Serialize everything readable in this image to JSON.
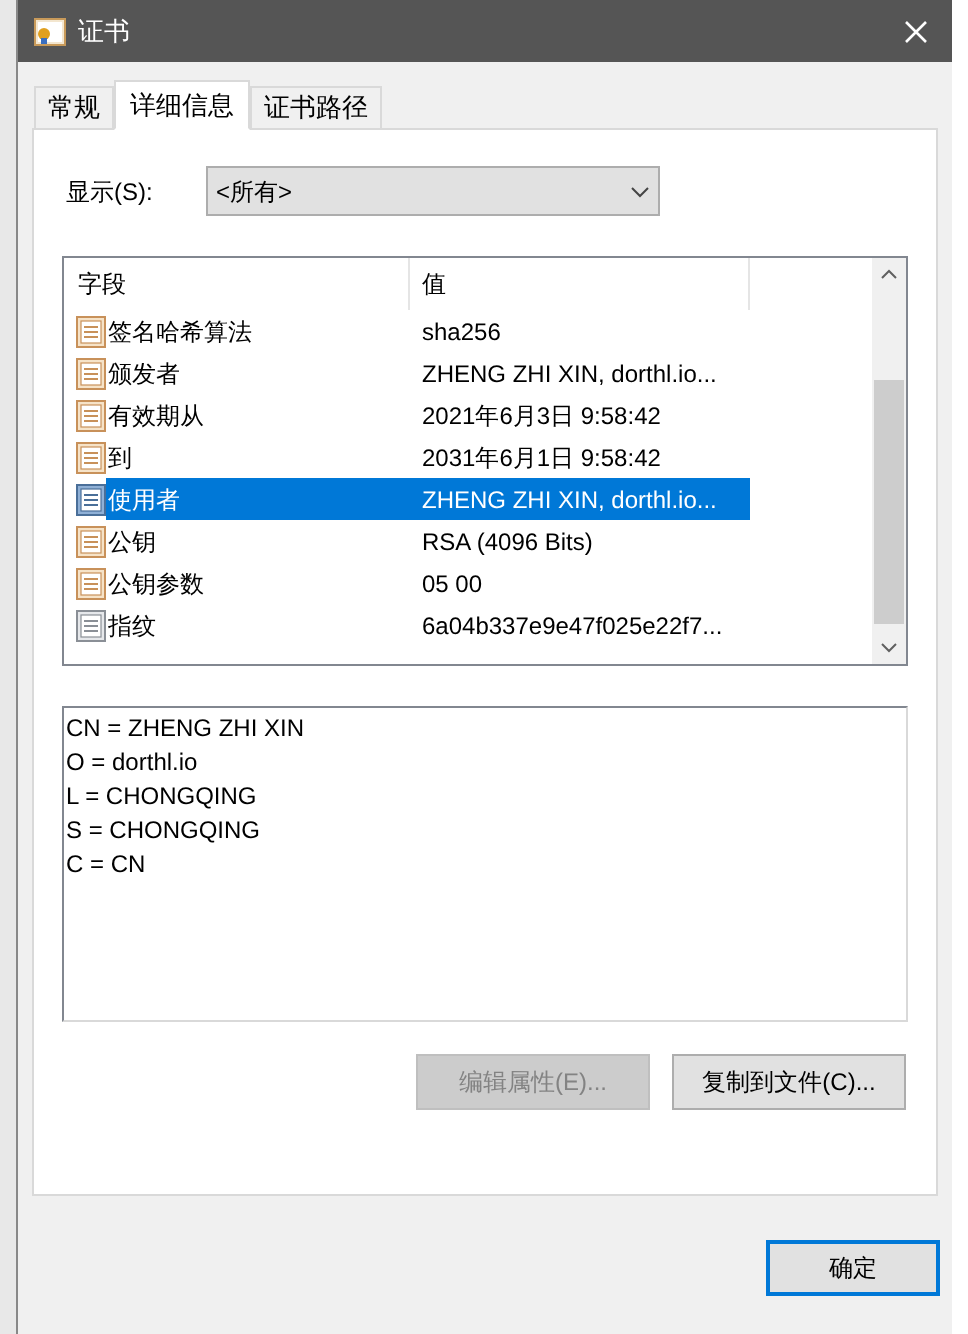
{
  "window": {
    "title": "证书"
  },
  "tabs": [
    {
      "label": "常规",
      "selected": false
    },
    {
      "label": "详细信息",
      "selected": true
    },
    {
      "label": "证书路径",
      "selected": false
    }
  ],
  "show": {
    "label": "显示(S):",
    "value": "<所有>"
  },
  "table": {
    "columns": [
      "字段",
      "值"
    ],
    "rows": [
      {
        "field": "签名哈希算法",
        "value": "sha256",
        "kind": "field",
        "selected": false
      },
      {
        "field": "颁发者",
        "value": "ZHENG ZHI XIN, dorthl.io...",
        "kind": "field",
        "selected": false
      },
      {
        "field": "有效期从",
        "value": "2021年6月3日 9:58:42",
        "kind": "field",
        "selected": false
      },
      {
        "field": "到",
        "value": "2031年6月1日 9:58:42",
        "kind": "field",
        "selected": false
      },
      {
        "field": "使用者",
        "value": "ZHENG ZHI XIN, dorthl.io...",
        "kind": "field",
        "selected": true
      },
      {
        "field": "公钥",
        "value": "RSA (4096 Bits)",
        "kind": "field",
        "selected": false
      },
      {
        "field": "公钥参数",
        "value": "05 00",
        "kind": "field",
        "selected": false
      },
      {
        "field": "指纹",
        "value": "6a04b337e9e47f025e22f7...",
        "kind": "property",
        "selected": false
      }
    ]
  },
  "details": [
    "CN = ZHENG ZHI XIN",
    "O = dorthl.io",
    "L = CHONGQING",
    "S = CHONGQING",
    "C = CN"
  ],
  "buttons": [
    {
      "label": "编辑属性(E)...",
      "disabled": true
    },
    {
      "label": "复制到文件(C)...",
      "disabled": false
    }
  ],
  "ok_button": "确定"
}
